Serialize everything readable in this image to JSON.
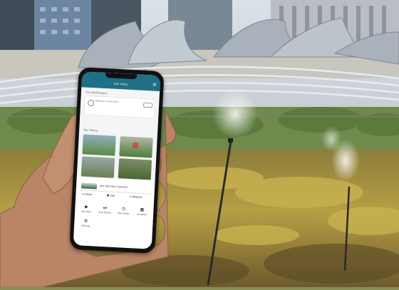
{
  "phone_app": {
    "header_title": "Jain Unity",
    "notifications_label": "Your Notifications",
    "notification_text": "Welcome to Jain Unity ...",
    "photos_label": "Your Photos",
    "product_title": "Jain Sprinkler Systems",
    "actions": [
      {
        "icon": "email-icon",
        "label": "Email"
      },
      {
        "icon": "phone-icon",
        "label": "Call"
      },
      {
        "icon": "website-icon",
        "label": "Website"
      }
    ],
    "grid": [
      {
        "icon": "play-icon",
        "label": "Run Now"
      },
      {
        "icon": "skip-icon",
        "label": "Skip Station"
      },
      {
        "icon": "clock-icon",
        "label": "Rain Delay"
      },
      {
        "icon": "calendar-icon",
        "label": "Schedule"
      },
      {
        "icon": "settings-icon",
        "label": "Settings"
      }
    ]
  },
  "colors": {
    "app_header": "#1f6f86",
    "sky": "#cfd8e0",
    "shrubs": "#6f8a4a",
    "grass": "#a89a47"
  }
}
